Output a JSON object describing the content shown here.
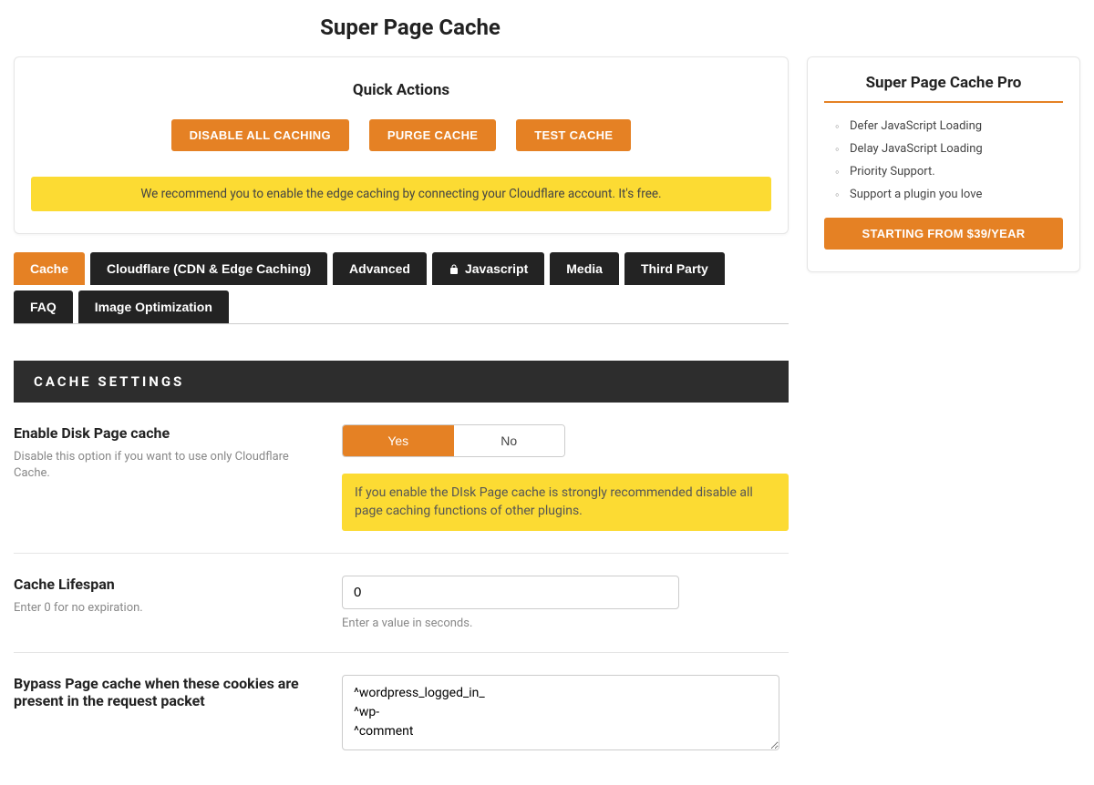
{
  "page_title": "Super Page Cache",
  "quick_actions": {
    "title": "Quick Actions",
    "buttons": [
      "DISABLE ALL CACHING",
      "PURGE CACHE",
      "TEST CACHE"
    ],
    "alert": "We recommend you to enable the edge caching by connecting your Cloudflare account. It's free."
  },
  "pro": {
    "title": "Super Page Cache Pro",
    "features": [
      "Defer JavaScript Loading",
      "Delay JavaScript Loading",
      "Priority Support.",
      "Support a plugin you love"
    ],
    "cta": "STARTING FROM $39/YEAR"
  },
  "tabs": [
    "Cache",
    "Cloudflare (CDN & Edge Caching)",
    "Advanced",
    "Javascript",
    "Media",
    "Third Party",
    "FAQ",
    "Image Optimization"
  ],
  "section_header": "CACHE SETTINGS",
  "settings": {
    "disk_cache": {
      "label": "Enable Disk Page cache",
      "desc": "Disable this option if you want to use only Cloudflare Cache.",
      "yes": "Yes",
      "no": "No",
      "warn": "If you enable the DIsk Page cache is strongly recommended disable all page caching functions of other plugins."
    },
    "lifespan": {
      "label": "Cache Lifespan",
      "desc": "Enter 0 for no expiration.",
      "value": "0",
      "help": "Enter a value in seconds."
    },
    "bypass": {
      "label": "Bypass Page cache when these cookies are present in the request packet",
      "value": "^wordpress_logged_in_\n^wp-\n^comment"
    }
  }
}
